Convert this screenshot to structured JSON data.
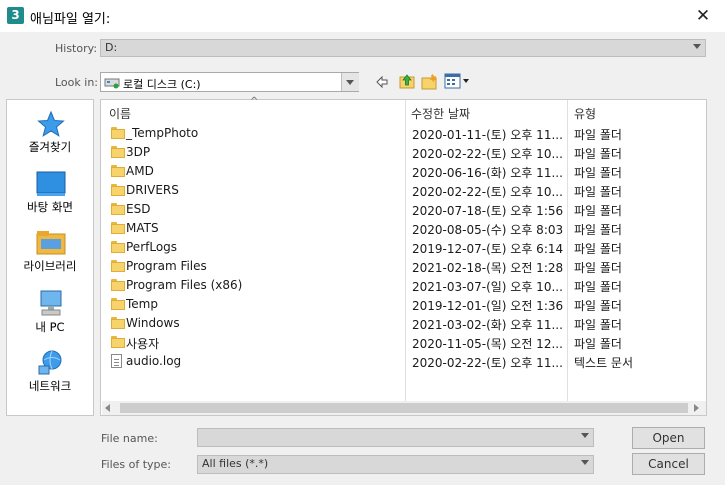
{
  "window": {
    "title": "애님파일 열기:",
    "app_icon_char": "3",
    "close_glyph": "✕"
  },
  "history": {
    "label": "History:",
    "value": "D:"
  },
  "lookin": {
    "label": "Look in:",
    "value": "로컬 디스크 (C:)"
  },
  "sidebar": {
    "items": [
      {
        "label": "즐겨찾기",
        "icon": "star-icon"
      },
      {
        "label": "바탕 화면",
        "icon": "desktop-icon"
      },
      {
        "label": "라이브러리",
        "icon": "library-icon"
      },
      {
        "label": "내 PC",
        "icon": "pc-icon"
      },
      {
        "label": "네트워크",
        "icon": "network-icon"
      }
    ]
  },
  "filelist": {
    "columns": [
      "이름",
      "수정한 날짜",
      "유형"
    ],
    "sort_indicator": "^",
    "rows": [
      {
        "name": "_TempPhoto",
        "date": "2020-01-11-(토) 오후 11...",
        "type": "파일 폴더",
        "icon": "folder-icon"
      },
      {
        "name": "3DP",
        "date": "2020-02-22-(토) 오후 10...",
        "type": "파일 폴더",
        "icon": "folder-icon"
      },
      {
        "name": "AMD",
        "date": "2020-06-16-(화) 오후 11...",
        "type": "파일 폴더",
        "icon": "folder-icon"
      },
      {
        "name": "DRIVERS",
        "date": "2020-02-22-(토) 오후 10...",
        "type": "파일 폴더",
        "icon": "folder-icon"
      },
      {
        "name": "ESD",
        "date": "2020-07-18-(토) 오후 1:56",
        "type": "파일 폴더",
        "icon": "folder-icon"
      },
      {
        "name": "MATS",
        "date": "2020-08-05-(수) 오후 8:03",
        "type": "파일 폴더",
        "icon": "folder-icon"
      },
      {
        "name": "PerfLogs",
        "date": "2019-12-07-(토) 오후 6:14",
        "type": "파일 폴더",
        "icon": "folder-icon"
      },
      {
        "name": "Program Files",
        "date": "2021-02-18-(목) 오전 1:28",
        "type": "파일 폴더",
        "icon": "folder-icon"
      },
      {
        "name": "Program Files (x86)",
        "date": "2021-03-07-(일) 오후 10...",
        "type": "파일 폴더",
        "icon": "folder-icon"
      },
      {
        "name": "Temp",
        "date": "2019-12-01-(일) 오전 1:36",
        "type": "파일 폴더",
        "icon": "folder-icon"
      },
      {
        "name": "Windows",
        "date": "2021-03-02-(화) 오후 11...",
        "type": "파일 폴더",
        "icon": "folder-icon"
      },
      {
        "name": "사용자",
        "date": "2020-11-05-(목) 오전 12...",
        "type": "파일 폴더",
        "icon": "folder-icon"
      },
      {
        "name": "audio.log",
        "date": "2020-02-22-(토) 오후 11...",
        "type": "텍스트 문서",
        "icon": "file-icon"
      }
    ]
  },
  "bottom": {
    "filename_label": "File name:",
    "filename_value": "",
    "filetype_label": "Files of type:",
    "filetype_value": "All files (*.*)",
    "open_label": "Open",
    "cancel_label": "Cancel"
  },
  "colors": {
    "folder": "#f6d36b",
    "accent": "#1f8b8b"
  }
}
